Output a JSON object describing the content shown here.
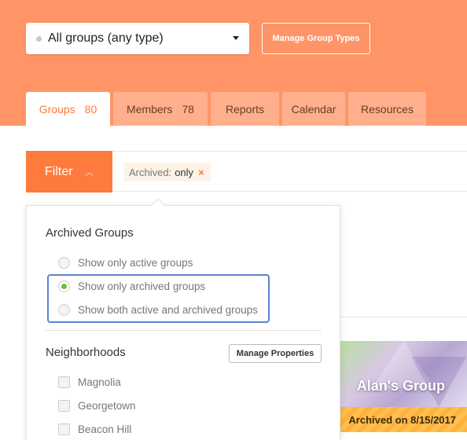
{
  "header": {
    "group_type_select": {
      "value": "All groups (any type)"
    },
    "manage_group_types_label": "Manage Group Types"
  },
  "tabs": [
    {
      "label": "Groups",
      "count": "80"
    },
    {
      "label": "Members",
      "count": "78"
    },
    {
      "label": "Reports",
      "count": ""
    },
    {
      "label": "Calendar",
      "count": ""
    },
    {
      "label": "Resources",
      "count": ""
    }
  ],
  "filter": {
    "button_label": "Filter",
    "chip_key": "Archived:",
    "chip_value": "only",
    "chip_remove": "×"
  },
  "panel": {
    "archived_title": "Archived Groups",
    "archived_options": [
      "Show only active groups",
      "Show only archived groups",
      "Show both active and archived groups"
    ],
    "selected_archived_option": 1,
    "neighborhoods_title": "Neighborhoods",
    "manage_properties_label": "Manage Properties",
    "neighborhoods": [
      "Magnolia",
      "Georgetown",
      "Beacon Hill"
    ]
  },
  "background_card": {
    "name": "Alan's Group",
    "archived_text": "Archived on 8/15/2017"
  },
  "colors": {
    "header_bg": "#ff9466",
    "accent": "#ff7a3d",
    "highlight_border": "#5b83d1",
    "radio_selected": "#6cbf3c"
  }
}
